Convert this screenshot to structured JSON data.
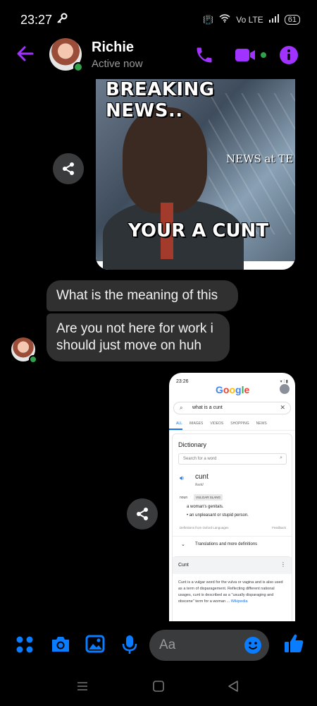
{
  "status": {
    "time": "23:27",
    "battery": "61",
    "signal": "Vo LTE"
  },
  "header": {
    "name": "Richie",
    "status": "Active now"
  },
  "news_image": {
    "top_text": "BREAKING NEWS..",
    "channel_text": "NEWS at TE",
    "bottom_text": "YOUR A CUNT"
  },
  "messages": [
    {
      "text": "What is the meaning of this"
    },
    {
      "text": "Are you not here for work i should just move on huh"
    }
  ],
  "google_shot": {
    "time": "23:26",
    "logo": "Google",
    "query": "what is a cunt",
    "tabs": [
      "ALL",
      "IMAGES",
      "VIDEOS",
      "SHOPPING",
      "NEWS"
    ],
    "dictionary_title": "Dictionary",
    "search_placeholder": "Search for a word",
    "word": "cunt",
    "pronunciation": "/kʌnt/",
    "part_of_speech": "noun",
    "tag": "VULGAR SLANG",
    "definition_1": "a woman's genitals.",
    "definition_2": "• an unpleasant or stupid person.",
    "source": "Definitions from Oxford Languages",
    "feedback": "Feedback",
    "more": "Translations and more definitions",
    "wiki_title": "Cunt",
    "wiki_text": "Cunt is a vulgar word for the vulva or vagina and is also used as a term of disparagement. Reflecting different national usages, cunt is described as a \"usually disparaging and obscene\" term for a woman ...",
    "wiki_link": "Wikipedia"
  },
  "composer": {
    "placeholder": "Aa"
  },
  "colors": {
    "accent": "#a033ff",
    "blue": "#0a7cff",
    "bubble": "#303030"
  }
}
